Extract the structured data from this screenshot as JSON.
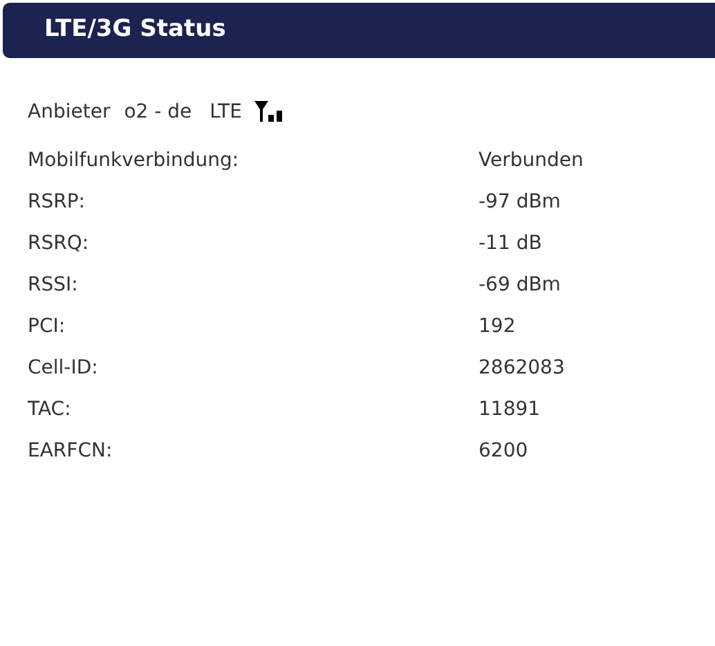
{
  "header": {
    "title": "LTE/3G Status"
  },
  "provider": {
    "label": "Anbieter",
    "name": "o2 - de",
    "technology": "LTE"
  },
  "rows": [
    {
      "label": "Mobilfunkverbindung:",
      "value": "Verbunden"
    },
    {
      "label": "RSRP:",
      "value": "-97 dBm"
    },
    {
      "label": "RSRQ:",
      "value": "-11 dB"
    },
    {
      "label": "RSSI:",
      "value": "-69 dBm"
    },
    {
      "label": "PCI:",
      "value": "192"
    },
    {
      "label": "Cell-ID:",
      "value": "2862083"
    },
    {
      "label": "TAC:",
      "value": "11891"
    },
    {
      "label": "EARFCN:",
      "value": "6200"
    }
  ]
}
